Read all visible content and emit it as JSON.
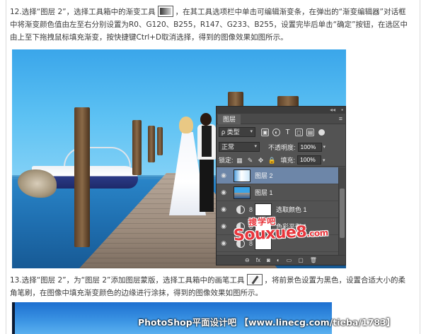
{
  "tutorial": {
    "step12": {
      "text_before_icon": "12.选择“图层 2”，选择工具箱中的渐变工具",
      "text_after_icon": "，在其工具选项栏中单击可编辑渐变条，在弹出的“渐变编辑器”对话框中将渐变颜色值由左至右分别设置为R0、G120、B255，R147、G233、B255，设置完毕后单击“确定”按钮，在选区中由上至下拖拽鼠标填充渐变，按快捷键Ctrl+D取消选择，得到的图像效果如图所示。"
    },
    "step13": {
      "text_before_icon": "13.选择“图层 2”，为“图层 2”添加图层蒙版，选择工具箱中的画笔工具",
      "text_after_icon": "，将前景色设置为黑色，设置合适大小的柔角笔刷，在图像中填充渐变颜色的边缘进行涂抹，得到的图像效果如图所示。"
    }
  },
  "tool_icons": {
    "gradient": "gradient-tool-icon",
    "brush": "brush-tool-icon"
  },
  "layers_panel": {
    "tab": "图层",
    "collapse_glyph": "◂◂",
    "close_glyph": "▪",
    "menu_glyph": "≡",
    "filter_select": "ρ 类型",
    "filter_icons": [
      "image-filter-icon",
      "adjustment-filter-icon",
      "type-filter-icon",
      "shape-filter-icon",
      "smart-object-filter-icon"
    ],
    "blend_mode": "正常",
    "opacity_label": "不透明度:",
    "opacity_value": "100%",
    "lock_label": "锁定:",
    "fill_label": "填充:",
    "fill_value": "100%",
    "layers": [
      {
        "name": "图层 2",
        "thumb": "gradient",
        "selected": true
      },
      {
        "name": "图层 1",
        "thumb": "photo",
        "selected": false
      },
      {
        "name": "选取颜色 1",
        "thumb": "adjustment",
        "selected": false
      },
      {
        "name": "色彩平衡 1",
        "thumb": "adjustment",
        "selected": false
      },
      {
        "name": "",
        "thumb": "adjustment",
        "selected": false
      }
    ],
    "footer_icons": [
      "link-icon",
      "fx-icon",
      "mask-icon",
      "adjustment-icon",
      "group-icon",
      "new-layer-icon",
      "trash-icon"
    ]
  },
  "watermarks": {
    "site_cn": "搜学吧",
    "site_logo": "Souxue8",
    "site_logo_suffix": ".com",
    "footer_credit": "PhotoShop平面设计吧 【www.linecg.com/tieba/1783】"
  },
  "colors": {
    "selected_layer": "#6d86a8",
    "panel_bg": "#535353",
    "watermark_red": "#e8363c"
  }
}
